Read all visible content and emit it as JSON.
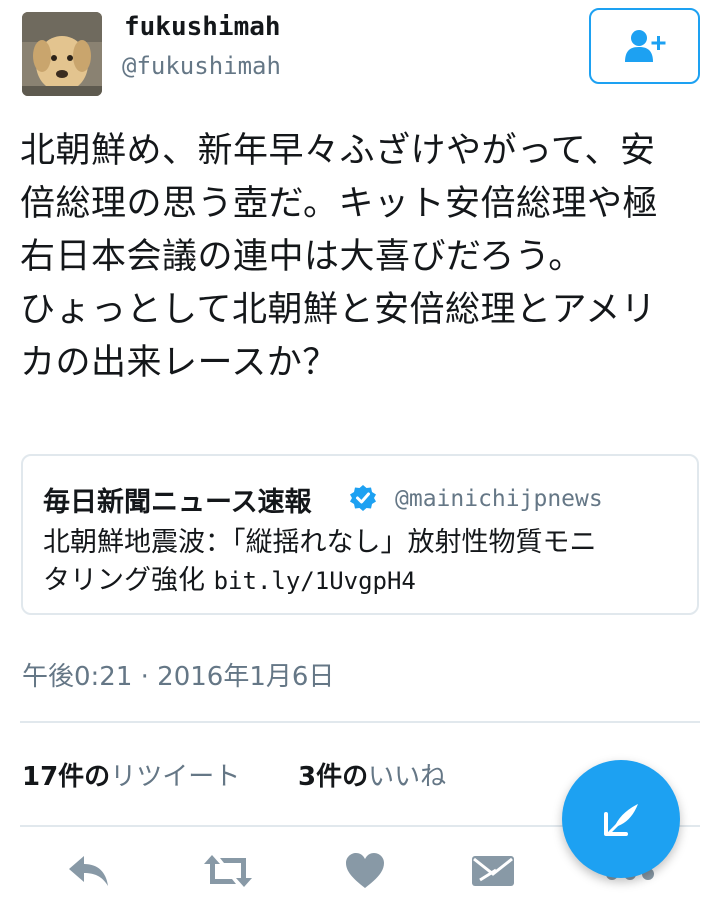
{
  "user": {
    "display_name": "fukushimah",
    "handle": "@fukushimah"
  },
  "tweet": {
    "text": "北朝鮮め、新年早々ふざけやがって、安\n倍総理の思う壺だ。キット安倍総理や極\n右日本会議の連中は大喜びだろう。\nひょっとして北朝鮮と安倍総理とアメリ\nカの出来レースか？"
  },
  "quoted": {
    "name": "毎日新聞ニュース速報",
    "handle": "@mainichijpnews",
    "text_line1": "北朝鮮地震波：「縦揺れなし」放射性物質モニ",
    "text_line2": "タリング強化 ",
    "link": "bit.ly/1UvgpH4"
  },
  "timestamp": "午後0:21 · 2016年1月6日",
  "stats": {
    "retweets_count": "17件の",
    "retweets_label": "リツイート",
    "likes_count": "3件の",
    "likes_label": "いいね"
  },
  "icons": {
    "follow": "add-user-icon",
    "verified": "verified-badge-icon",
    "reply": "reply-icon",
    "retweet": "retweet-icon",
    "like": "heart-icon",
    "dm": "envelope-icon",
    "more": "more-icon",
    "compose": "compose-icon"
  },
  "colors": {
    "accent": "#1da1f2",
    "text": "#14171a",
    "muted": "#657786",
    "icon_gray": "#8899a6"
  }
}
